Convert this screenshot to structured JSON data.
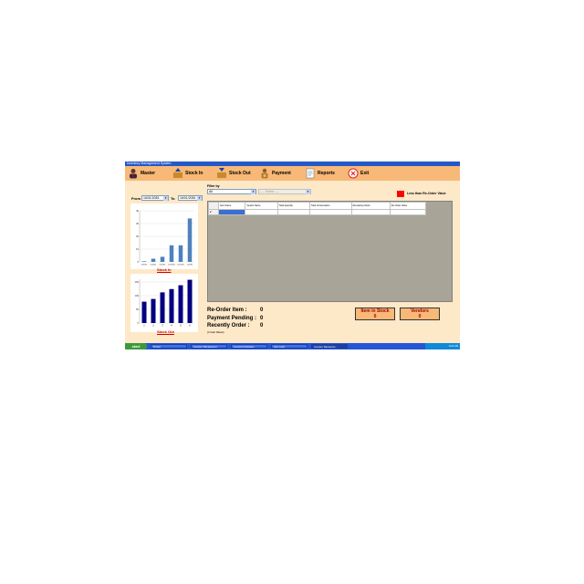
{
  "window": {
    "title": "Inventory Management System"
  },
  "menu": [
    {
      "label": "Master",
      "icon": "user-icon"
    },
    {
      "label": "Stock In",
      "icon": "box-in-icon"
    },
    {
      "label": "Stock Out",
      "icon": "box-out-icon"
    },
    {
      "label": "Payment",
      "icon": "payment-icon"
    },
    {
      "label": "Reports",
      "icon": "reports-icon"
    },
    {
      "label": "Exit",
      "icon": "exit-icon"
    }
  ],
  "date_range": {
    "from_label": "From",
    "from_value": "16/01/2081",
    "to_label": "To",
    "to_value": "16/01/2081"
  },
  "filter": {
    "label": "Filter by",
    "value": "All",
    "secondary": "---- Select ----"
  },
  "legend": {
    "text": "Less than Re-Order Value",
    "color": "#ff0000"
  },
  "grid": {
    "columns": [
      "Item Name",
      "Vendor Name",
      "Total Quantity",
      "Total Consumation",
      "Remaining Stock",
      "Re-Order Value"
    ],
    "row_marker": "▸*"
  },
  "charts": {
    "stock_in": {
      "link": "Stock In",
      "chart_data": {
        "type": "bar",
        "categories": [
          "4/2081",
          "5/2081",
          "6/2081",
          "10/2081",
          "12/2081",
          "1/2081"
        ],
        "values": [
          0.5,
          2.5,
          4,
          13,
          13,
          34
        ],
        "ylim": [
          0,
          40
        ],
        "yticks": [
          0,
          10,
          20,
          30,
          40
        ],
        "color": "#4f81bd"
      }
    },
    "stock_out": {
      "link": "Stock Out",
      "chart_data": {
        "type": "bar",
        "categories": [
          "1",
          "2",
          "3",
          "4",
          "5",
          "6"
        ],
        "values": [
          78,
          88,
          112,
          124,
          138,
          158
        ],
        "ylim": [
          0,
          160
        ],
        "yticks": [
          0,
          50,
          100,
          150
        ],
        "color": "#000080"
      }
    }
  },
  "summary": {
    "reorder": {
      "label": "Re-Order Item :",
      "value": "0"
    },
    "payment": {
      "label": "Payment Pending :",
      "value": "0"
    },
    "recent": {
      "label": "Recently Order :",
      "value": "0",
      "note": "(In last Week)"
    }
  },
  "boxes": {
    "stock": {
      "label": "Item in Stock",
      "value": "0"
    },
    "vendors": {
      "label": "Vendors",
      "value": "0"
    }
  },
  "taskbar": {
    "start": "start",
    "tasks": [
      "Project",
      "Inventory Management",
      "InventoryApplication",
      "User Login",
      "Inventory Manageme..."
    ],
    "clock": "11:41 AM"
  }
}
